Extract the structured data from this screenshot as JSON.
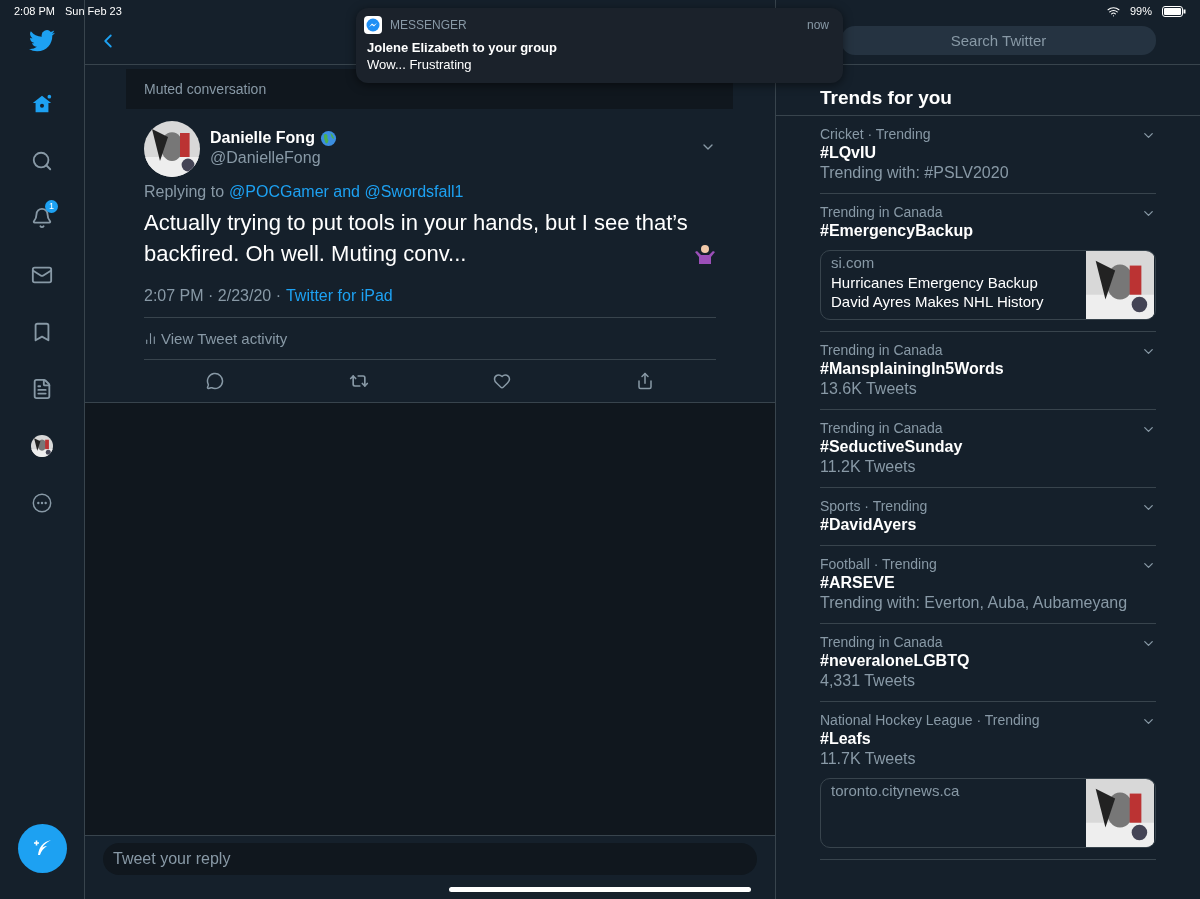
{
  "status_bar": {
    "time": "2:08 PM",
    "date": "Sun Feb 23",
    "battery": "99%"
  },
  "sidebar": {
    "items": [
      {
        "kind": "home",
        "selected": true
      },
      {
        "kind": "search",
        "selected": false
      },
      {
        "kind": "notifications",
        "selected": false,
        "badge": "1"
      },
      {
        "kind": "messages",
        "selected": false
      },
      {
        "kind": "bookmarks",
        "selected": false
      },
      {
        "kind": "lists",
        "selected": false
      },
      {
        "kind": "profile",
        "selected": false
      },
      {
        "kind": "more",
        "selected": false
      }
    ]
  },
  "notification": {
    "app": "MESSENGER",
    "time": "now",
    "title": "Jolene Elizabeth to your group",
    "body": "Wow... Frustrating"
  },
  "thread": {
    "muted_label": "Muted conversation",
    "tweet": {
      "name": "Danielle Fong",
      "handle": "@DanielleFong",
      "replying_label": "Replying to",
      "replying_to": "@POCGamer and @Swordsfall1",
      "text": "Actually trying to put tools in your hands, but I see that’s backfired. Oh well. Muting conv...",
      "timestamp": "2:07 PM · 2/23/20 ·",
      "source": "Twitter for iPad",
      "activity": "View Tweet activity"
    },
    "reply_placeholder": "Tweet your reply"
  },
  "search": {
    "placeholder": "Search Twitter"
  },
  "trends": {
    "title": "Trends for you",
    "items": [
      {
        "meta": "Cricket · Trending",
        "tag": "#LQvIU",
        "sub": "Trending with: #PSLV2020"
      },
      {
        "meta": "Trending in Canada",
        "tag": "#EmergencyBackup",
        "card": {
          "source": "si.com",
          "headline": "Hurricanes Emergency Backup David Ayres Makes NHL History"
        }
      },
      {
        "meta": "Trending in Canada",
        "tag": "#MansplainingIn5Words",
        "sub": "13.6K Tweets"
      },
      {
        "meta": "Trending in Canada",
        "tag": "#SeductiveSunday",
        "sub": "11.2K Tweets"
      },
      {
        "meta": "Sports · Trending",
        "tag": "#DavidAyers"
      },
      {
        "meta": "Football · Trending",
        "tag": "#ARSEVE",
        "sub": "Trending with: Everton, Auba, Aubameyang"
      },
      {
        "meta": "Trending in Canada",
        "tag": "#neveraloneLGBTQ",
        "sub": "4,331 Tweets"
      },
      {
        "meta": "National Hockey League · Trending",
        "tag": "#Leafs",
        "sub": "11.7K Tweets",
        "card": {
          "source": "toronto.citynews.ca"
        }
      }
    ]
  }
}
